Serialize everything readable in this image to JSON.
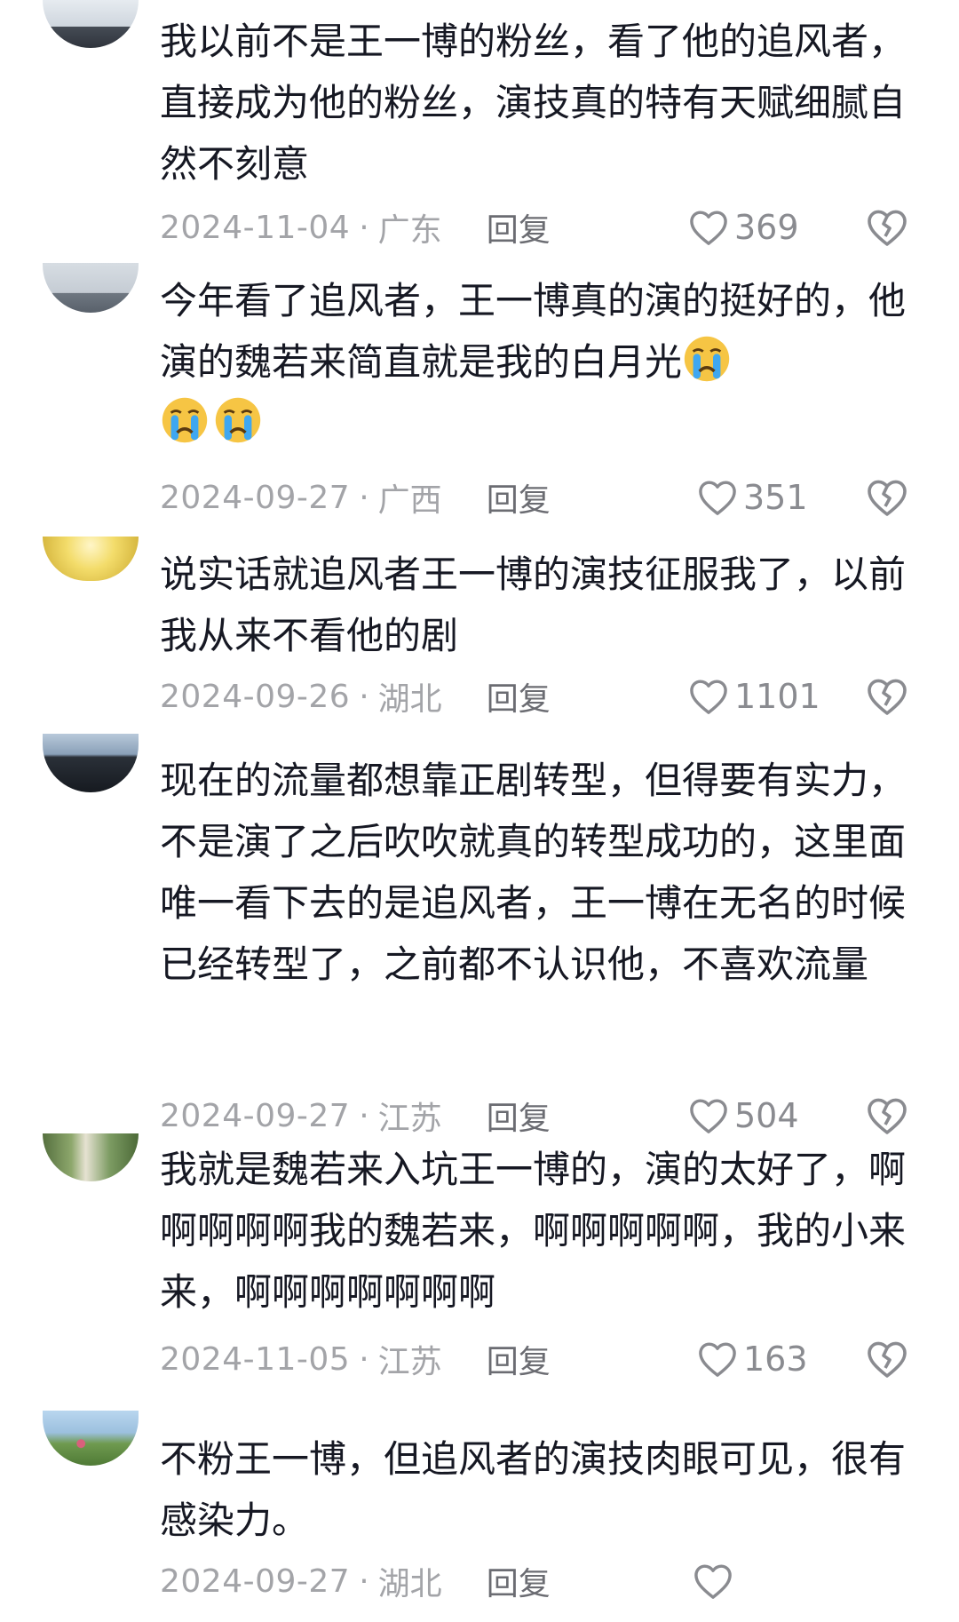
{
  "comments": [
    {
      "text": "我以前不是王一博的粉丝，看了他的追风者，直接成为他的粉丝，演技真的特有天赋细腻自然不刻意",
      "emojis": 0,
      "date": "2024-11-04",
      "location": "广东",
      "reply": "回复",
      "likes": "369",
      "avatar_colors": [
        "#dde3ea",
        "#3a3f48"
      ]
    },
    {
      "text": "今年看了追风者，王一博真的演的挺好的，他演的魏若来简直就是我的白月光",
      "emojis": 3,
      "date": "2024-09-27",
      "location": "广西",
      "reply": "回复",
      "likes": "351",
      "avatar_colors": [
        "#c9d0d8",
        "#6d7682"
      ]
    },
    {
      "text": "说实话就追风者王一博的演技征服我了，以前我从来不看他的剧",
      "emojis": 0,
      "date": "2024-09-26",
      "location": "湖北",
      "reply": "回复",
      "likes": "1101",
      "avatar_colors": [
        "#f4e27a",
        "#c9b240"
      ]
    },
    {
      "text": "现在的流量都想靠正剧转型，但得要有实力，不是演了之后吹吹就真的转型成功的，这里面唯一看下去的是追风者，王一博在无名的时候已经转型了，之前都不认识他，不喜欢流量",
      "emojis": 0,
      "date": "2024-09-27",
      "location": "江苏",
      "reply": "回复",
      "likes": "504",
      "avatar_colors": [
        "#9fb3c8",
        "#1f2630"
      ]
    },
    {
      "text": "我就是魏若来入坑王一博的，演的太好了，啊啊啊啊啊我的魏若来，啊啊啊啊啊，我的小来来，啊啊啊啊啊啊啊",
      "emojis": 0,
      "date": "2024-11-05",
      "location": "江苏",
      "reply": "回复",
      "likes": "163",
      "avatar_colors": [
        "#6e8a5a",
        "#d9d4c2"
      ]
    },
    {
      "text": "不粉王一博，但追风者的演技肉眼可见，很有感染力。",
      "emojis": 0,
      "date": "2024-09-27",
      "location": "湖北",
      "reply": "回复",
      "likes": "",
      "avatar_colors": [
        "#a8c9e8",
        "#7aa25a"
      ]
    }
  ],
  "meta_separator": "·",
  "icons": {
    "like": "heart-outline-icon",
    "dislike": "broken-heart-icon",
    "emoji": "crying-face-emoji"
  },
  "colors": {
    "text": "#161823",
    "meta": "#a3a4a8",
    "reply": "#6b6c72",
    "icon": "#8a8b90"
  }
}
